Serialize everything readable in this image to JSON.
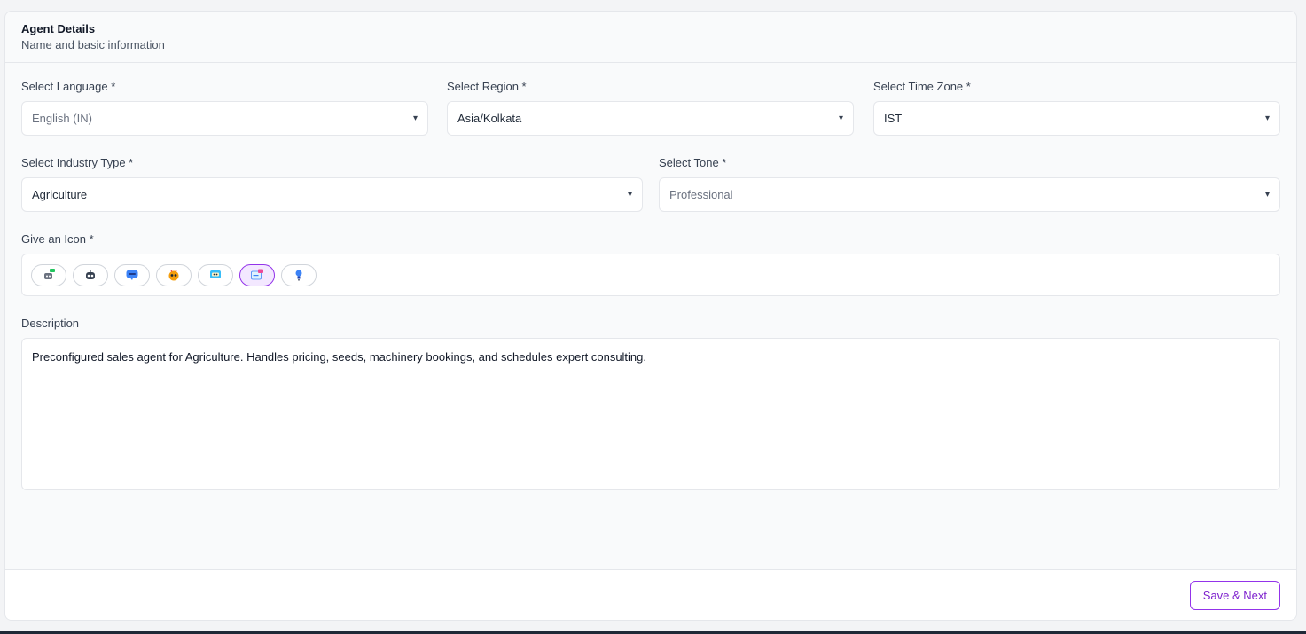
{
  "header": {
    "title": "Agent Details",
    "subtitle": "Name and basic information"
  },
  "fields": {
    "language": {
      "label": "Select Language *",
      "value": "English (IN)"
    },
    "region": {
      "label": "Select Region *",
      "value": "Asia/Kolkata"
    },
    "timezone": {
      "label": "Select Time Zone *",
      "value": "IST"
    },
    "industry": {
      "label": "Select Industry Type *",
      "value": "Agriculture"
    },
    "tone": {
      "label": "Select Tone *",
      "value": "Professional"
    }
  },
  "icons": {
    "label": "Give an Icon *",
    "items": [
      {
        "name": "robot-chat-icon",
        "selected": false
      },
      {
        "name": "robot-head-icon",
        "selected": false
      },
      {
        "name": "speech-bubble-icon",
        "selected": false
      },
      {
        "name": "bee-robot-icon",
        "selected": false
      },
      {
        "name": "monitor-robot-icon",
        "selected": false
      },
      {
        "name": "chat-window-icon",
        "selected": true
      },
      {
        "name": "lightbulb-person-icon",
        "selected": false
      }
    ]
  },
  "description": {
    "label": "Description",
    "value": "Preconfigured sales agent for Agriculture. Handles pricing, seeds, machinery bookings, and schedules expert consulting."
  },
  "footer": {
    "save_label": "Save & Next"
  },
  "caret": "▾",
  "colors": {
    "accent": "#9333ea",
    "border": "#e5e7eb",
    "background": "#f9fafb"
  }
}
